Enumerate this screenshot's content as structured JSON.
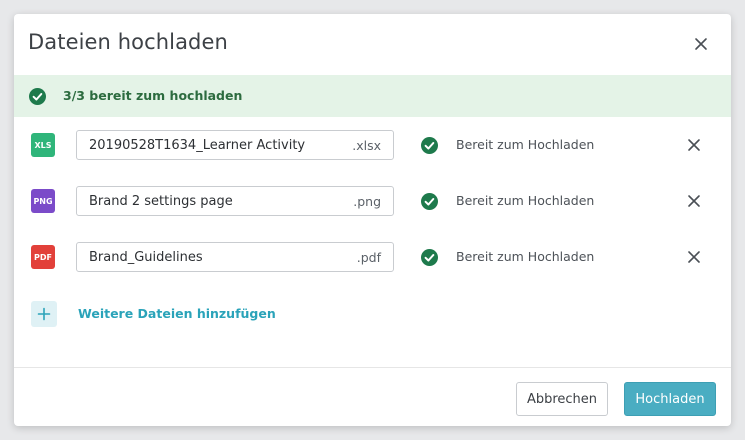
{
  "dialog": {
    "title": "Dateien hochladen"
  },
  "banner": {
    "text": "3/3 bereit zum hochladen"
  },
  "files": [
    {
      "type_badge": "XLS",
      "badge_color": "#2fb57a",
      "name": "20190528T1634_Learner Activity",
      "extension": ".xlsx",
      "status": "Bereit zum Hochladen"
    },
    {
      "type_badge": "PNG",
      "badge_color": "#7b4bc9",
      "name": "Brand 2 settings page",
      "extension": ".png",
      "status": "Bereit zum Hochladen"
    },
    {
      "type_badge": "PDF",
      "badge_color": "#e2403a",
      "name": "Brand_Guidelines",
      "extension": ".pdf",
      "status": "Bereit zum Hochladen"
    }
  ],
  "add_more": {
    "label": "Weitere Dateien hinzufügen"
  },
  "footer": {
    "cancel_label": "Abbrechen",
    "upload_label": "Hochladen"
  },
  "colors": {
    "accent": "#4aadc2",
    "success": "#1e7a4c",
    "banner_bg": "#e4f3e7"
  }
}
